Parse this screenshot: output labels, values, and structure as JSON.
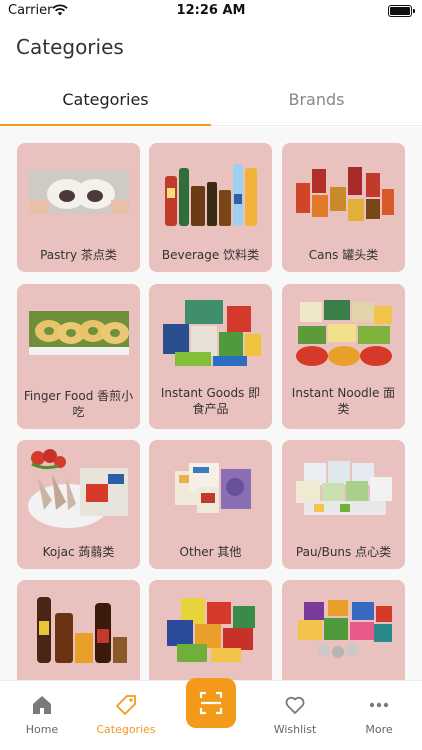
{
  "status": {
    "carrier": "Carrier",
    "time": "12:26 AM"
  },
  "page": {
    "title": "Categories"
  },
  "tabs": [
    {
      "label": "Categories",
      "active": true
    },
    {
      "label": "Brands",
      "active": false
    }
  ],
  "categories": [
    {
      "label": "Pastry 茶点类"
    },
    {
      "label": "Beverage 饮料类"
    },
    {
      "label": "Cans 罐头类"
    },
    {
      "label": "Finger Food 香煎小吃"
    },
    {
      "label": "Instant Goods 即食产品"
    },
    {
      "label": "Instant Noodle 面类"
    },
    {
      "label": "Kojac 蒟蒻类"
    },
    {
      "label": "Other 其他"
    },
    {
      "label": "Pau/Buns 点心类"
    },
    {
      "label": ""
    },
    {
      "label": ""
    },
    {
      "label": ""
    }
  ],
  "bottom_nav": [
    {
      "label": "Home",
      "icon": "home-icon",
      "active": false
    },
    {
      "label": "Categories",
      "icon": "tag-icon",
      "active": true
    },
    {
      "label": "",
      "icon": "scan-icon",
      "active": false
    },
    {
      "label": "Wishlist",
      "icon": "heart-icon",
      "active": false
    },
    {
      "label": "More",
      "icon": "more-icon",
      "active": false
    }
  ],
  "colors": {
    "accent": "#f39a1b",
    "card": "#e9c1be"
  }
}
